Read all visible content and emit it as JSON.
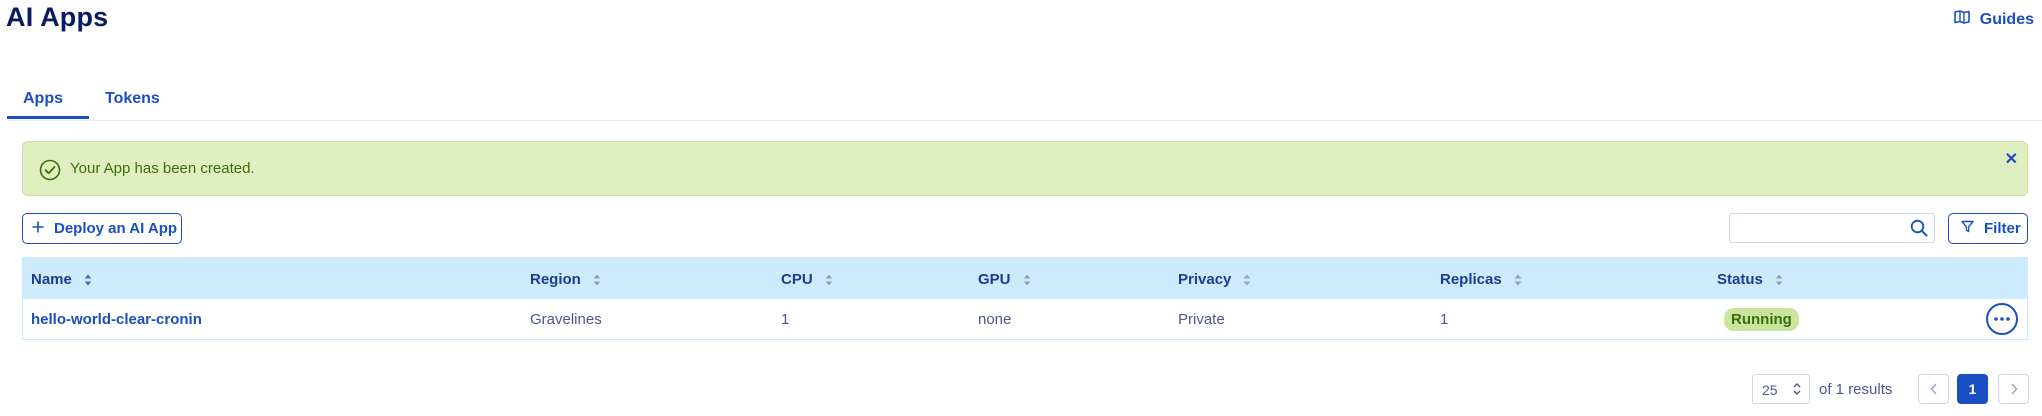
{
  "header": {
    "title": "AI Apps",
    "guides_label": "Guides",
    "guides_icon": "book-icon"
  },
  "tabs": [
    {
      "label": "Apps",
      "active": true
    },
    {
      "label": "Tokens",
      "active": false
    }
  ],
  "banner": {
    "message": "Your App has been created.",
    "type": "success",
    "close_glyph": "✕"
  },
  "toolbar": {
    "deploy_label": "Deploy an AI App",
    "search_placeholder": "",
    "filter_label": "Filter"
  },
  "table": {
    "columns": [
      "Name",
      "Region",
      "CPU",
      "GPU",
      "Privacy",
      "Replicas",
      "Status"
    ],
    "rows": [
      {
        "name": "hello-world-clear-cronin",
        "region": "Gravelines",
        "cpu": "1",
        "gpu": "none",
        "privacy": "Private",
        "replicas": "1",
        "status": "Running"
      }
    ]
  },
  "pagination": {
    "page_size": "25",
    "results_text": "of 1 results",
    "current_page": "1"
  },
  "colors": {
    "accent": "#1a4fc4",
    "title": "#0b1c64",
    "banner_bg": "#dfefc0",
    "header_bg": "#cdebfc",
    "status_running_bg": "#c8e49d"
  }
}
